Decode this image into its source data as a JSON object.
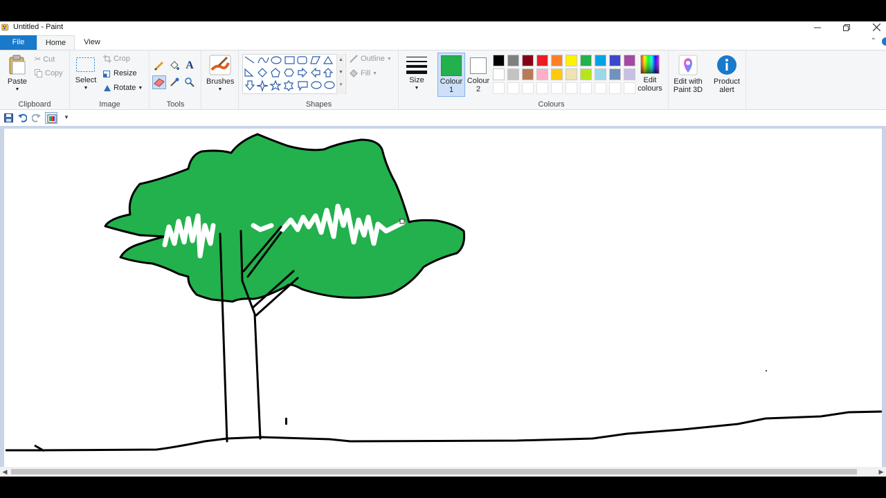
{
  "window": {
    "title": "Untitled - Paint"
  },
  "tabs": [
    {
      "label": "File"
    },
    {
      "label": "Home"
    },
    {
      "label": "View"
    }
  ],
  "clipboard": {
    "group_label": "Clipboard",
    "paste_label": "Paste",
    "cut_label": "Cut",
    "copy_label": "Copy"
  },
  "image": {
    "group_label": "Image",
    "select_label": "Select",
    "crop_label": "Crop",
    "resize_label": "Resize",
    "rotate_label": "Rotate"
  },
  "tools": {
    "group_label": "Tools",
    "brushes_label": "Brushes"
  },
  "shapes": {
    "group_label": "Shapes",
    "outline_label": "Outline",
    "fill_label": "Fill"
  },
  "size": {
    "label": "Size"
  },
  "colours": {
    "group_label": "Colours",
    "colour1_label": "Colour",
    "colour1_num": "1",
    "colour2_label": "Colour",
    "colour2_num": "2",
    "colour1_value": "#22b14c",
    "colour2_value": "#ffffff",
    "edit_colours_label": "Edit colours",
    "palette_row1": [
      "#000000",
      "#7f7f7f",
      "#880015",
      "#ed1c24",
      "#ff7f27",
      "#fff200",
      "#22b14c",
      "#00a2e8",
      "#3f48cc",
      "#a349a4"
    ],
    "palette_row2": [
      "#ffffff",
      "#c3c3c3",
      "#b97a57",
      "#ffaec9",
      "#ffc90e",
      "#efe4b0",
      "#b5e61d",
      "#99d9ea",
      "#7092be",
      "#c8bfe7"
    ]
  },
  "paint3d": {
    "label": "Edit with Paint 3D"
  },
  "product_alert": {
    "label": "Product alert"
  },
  "accent": "#1979ca"
}
